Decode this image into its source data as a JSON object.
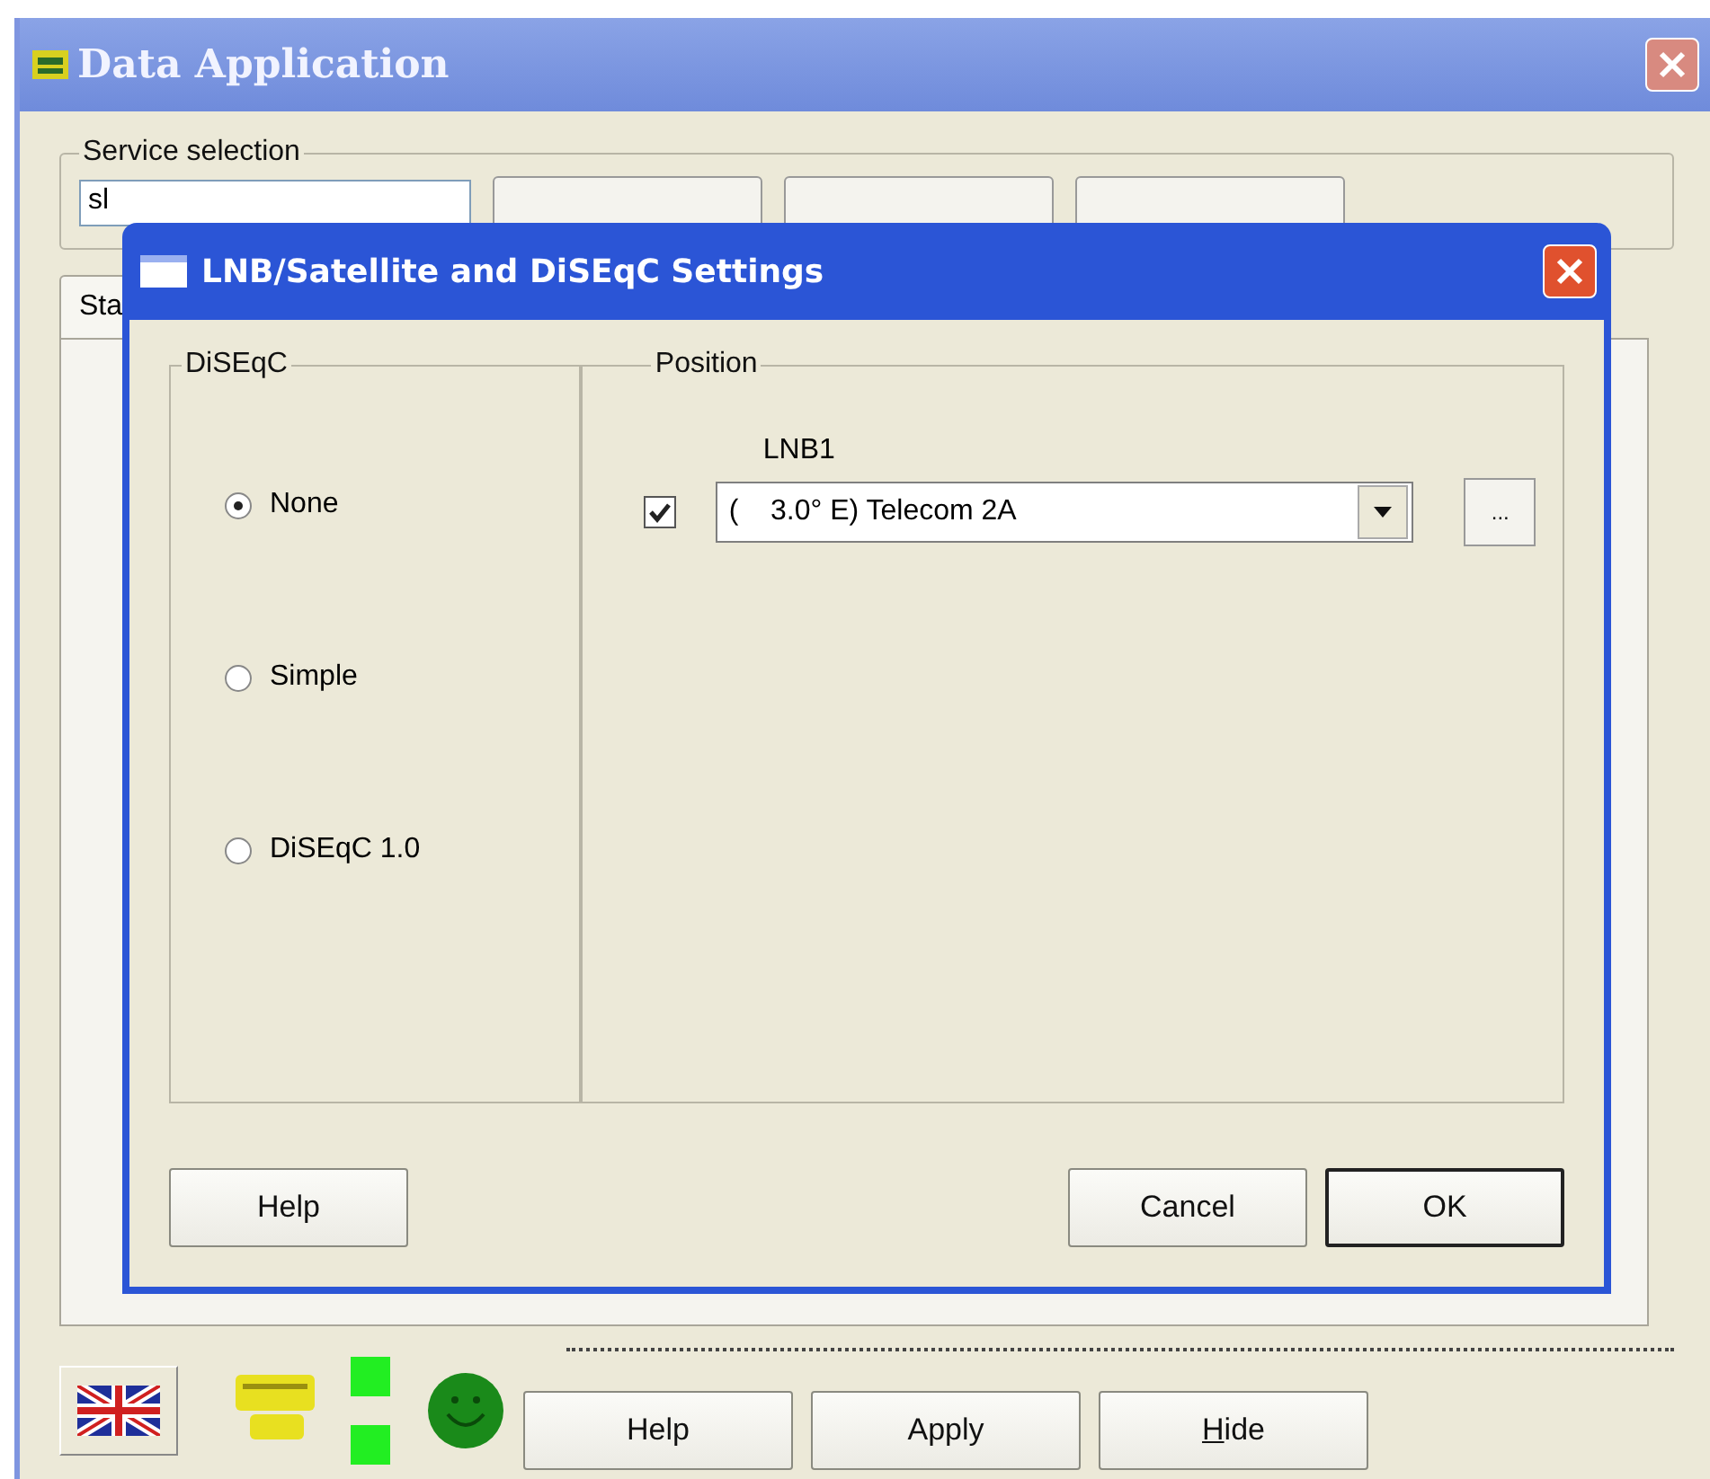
{
  "window": {
    "title": "Data Application"
  },
  "service_selection": {
    "label": "Service selection",
    "field_value": "sl"
  },
  "tabs": [
    {
      "label": "Sta",
      "selected": true
    }
  ],
  "footer": {
    "leds": [
      {
        "on": true
      },
      {
        "on": true
      }
    ],
    "buttons": [
      {
        "label": "Help",
        "mnemonic_first": false
      },
      {
        "label": "Apply",
        "mnemonic_first": false
      },
      {
        "label": "Hide",
        "mnemonic_first": true
      }
    ]
  },
  "dialog": {
    "title": "LNB/Satellite and DiSEqC Settings",
    "diseqc": {
      "label": "DiSEqC",
      "options": [
        {
          "label": "None",
          "selected": true
        },
        {
          "label": "Simple",
          "selected": false
        },
        {
          "label": "DiSEqC 1.0",
          "selected": false
        }
      ]
    },
    "position": {
      "label": "Position",
      "lnb_label": "LNB1",
      "enabled": true,
      "satellite": "(    3.0° E) Telecom 2A",
      "browse_button": "..."
    },
    "buttons": [
      {
        "label": "Help",
        "default": false
      },
      {
        "label": "Cancel",
        "default": false
      },
      {
        "label": "OK",
        "default": true
      }
    ]
  }
}
